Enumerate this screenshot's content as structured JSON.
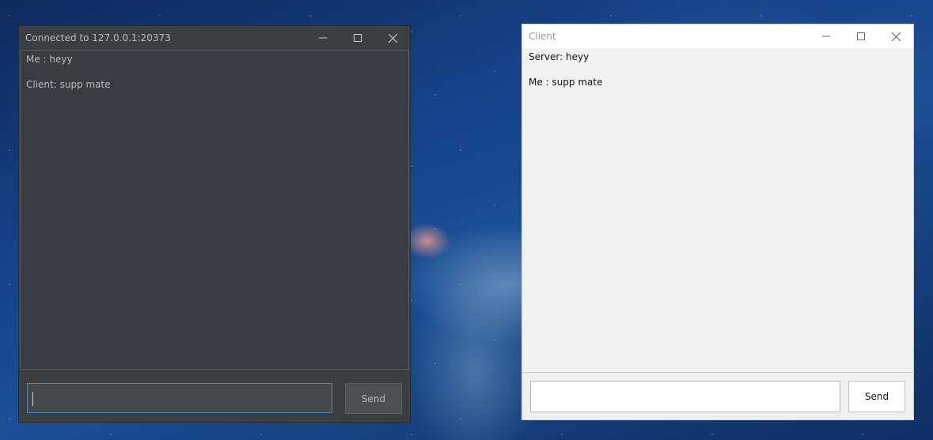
{
  "server_window": {
    "title": "Connected to 127.0.0.1:20373",
    "messages": [
      "Me : heyy",
      "Client: supp mate"
    ],
    "input_value": "",
    "send_label": "Send"
  },
  "client_window": {
    "title": "Client",
    "messages": [
      "Server: heyy",
      "Me : supp mate"
    ],
    "input_value": "",
    "send_label": "Send"
  },
  "icons": {
    "minimize": "minimize-icon",
    "maximize": "maximize-icon",
    "close": "close-icon"
  },
  "colors": {
    "dark_bg": "#3c3f41",
    "light_bg": "#f0f0f0",
    "focus_border": "#4a88c7"
  }
}
